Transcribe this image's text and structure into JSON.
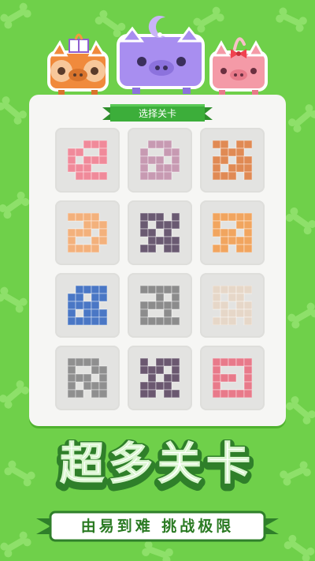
{
  "colors": {
    "background": "#6fd04a",
    "bone": "#8ee06a",
    "panel": "#f6f6f4",
    "tile": "#e3e3e1",
    "ribbon": "#3cae3a",
    "headline_text": "#ffffff",
    "headline_outline": "#2f7f2a"
  },
  "characters": [
    {
      "name": "orange-pig",
      "color": "#f08a3c",
      "accessory": "book-icon"
    },
    {
      "name": "purple-pig",
      "color": "#a88ef0",
      "accessory": "moon-icon"
    },
    {
      "name": "pink-pig",
      "color": "#f49aa7",
      "accessory": "bow-icon"
    }
  ],
  "panel": {
    "header_label": "选择关卡"
  },
  "levels": [
    {
      "color": "#f08a9a"
    },
    {
      "color": "#c79ab2"
    },
    {
      "color": "#e08a54"
    },
    {
      "color": "#f3b17c"
    },
    {
      "color": "#6a5a72"
    },
    {
      "color": "#f1a55f"
    },
    {
      "color": "#4a77c5"
    },
    {
      "color": "#8c8c8c"
    },
    {
      "color": "#e6d7c8"
    },
    {
      "color": "#8f8f8f"
    },
    {
      "color": "#6b5870"
    },
    {
      "color": "#e87a8a"
    }
  ],
  "headline": {
    "text": "超多关卡"
  },
  "subheadline": {
    "text": "由易到难  挑战极限"
  }
}
